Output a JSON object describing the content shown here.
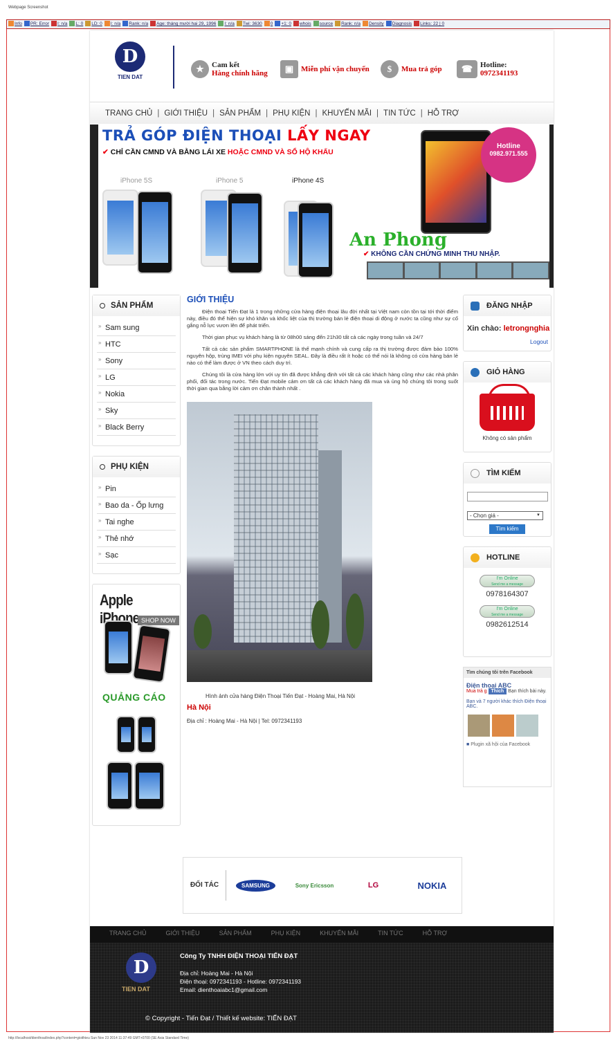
{
  "frame": {
    "title": "Webpage Screenshot",
    "status_url": "http://localhost/dienthoai/index.php?content=gioithieu Sun Nov 23 2014 11:37:49 GMT+0700 (SE Asia Standard Time)"
  },
  "seobar": {
    "items": [
      "Info",
      "PR: Error",
      "I: n/a",
      "L: 0",
      "LD: 0",
      "I: n/a",
      "Rank: n/a",
      "Age: tháng mười hai 29, 1996",
      "I: n/a",
      "Twi: 3630",
      "0",
      "+1: 0",
      "whois",
      "source",
      "Rank: n/a",
      "Density",
      "Diagnosis",
      "Links: 22 | 0"
    ]
  },
  "header": {
    "logo_text": "TIEN DAT",
    "features": [
      {
        "line1": "Cam kết",
        "line2": "Hàng chính hãng"
      },
      {
        "line1": "Miễn phí vận chuyển"
      },
      {
        "line1": "Mua trả góp"
      },
      {
        "line1": "Hotline:",
        "line2": "0972341193"
      }
    ]
  },
  "nav": [
    "TRANG CHỦ",
    "GIỚI THIỆU",
    "SẢN PHẨM",
    "PHỤ KIỆN",
    "KHUYẾN MÃI",
    "TIN TỨC",
    "HỖ TRỢ"
  ],
  "banner": {
    "title_a": "TRẢ GÓP ĐIỆN THOẠI",
    "title_b": "LẤY NGAY",
    "sub_a": "CHỈ CẦN CMND VÀ BẰNG LÁI XE",
    "sub_b": "HOẶC",
    "sub_c": "CMND VÀ SỔ HỘ KHẨU",
    "phones": [
      "iPhone 5S",
      "iPhone 5",
      "iPhone 4S"
    ],
    "hotline_label": "Hotline",
    "hotline_number": "0982.971.555",
    "brand": "An Phong",
    "bullet": "KHÔNG CẦN CHỨNG MINH THU NHẬP."
  },
  "left": {
    "products_title": "SẢN PHẨM",
    "products": [
      "Sam sung",
      "HTC",
      "Sony",
      "LG",
      "Nokia",
      "Sky",
      "Black Berry"
    ],
    "accessories_title": "PHỤ KIỆN",
    "accessories": [
      "Pin",
      "Bao da - Ốp lưng",
      "Tai nghe",
      "Thẻ nhớ",
      "Sạc"
    ],
    "ad_title": "Apple iPhone",
    "ad_shop": "SHOP NOW",
    "ads_label": "QUẢNG CÁO"
  },
  "main": {
    "title": "GIỚI THIỆU",
    "paragraphs": [
      "Điện thoại Tiến Đạt là 1 trong những cửa hàng điện thoại lâu đời nhất tại Việt nam còn tồn tại tới thời điểm này, điều đó thể hiện sự khó khăn và khốc liệt của thị trường bán lẻ điện thoại di động ở nước ta cũng như sự cố gắng nỗ lực vươn lên để phát triển.",
      "Thời gian phục vụ khách hàng là từ 08h00 sáng đến 21h30 tất cả các ngày trong tuần và 24/7",
      "Tất cả các sản phẩm SMARTPHONE là thế mạnh chính và cung cấp ra thị trường được đảm bảo 100% nguyên hộp, trùng IMEI với phụ kiện nguyên SEAL. Đây là điều rất ít hoặc có thể nói là không có cửa hàng bán lẻ nào có thể làm được ở VN theo cách duy trì.",
      "Chúng tôi là cửa hàng lớn với uy tín đã được khẳng định với tất cả các khách hàng cũng như các nhà phân phối, đối tác trong nước. Tiến Đạt mobile cảm ơn tất cả các khách hàng đã mua và ủng hộ chúng tôi trong suốt thời gian qua bằng lời cảm ơn chân thành nhất ."
    ],
    "caption": "Hình ảnh cửa hàng Điện Thoại Tiến Đạt - Hoàng Mai, Hà Nội",
    "city": "Hà Nội",
    "address": "Địa chỉ : Hoàng Mai - Hà Nội | Tel: 0972341193"
  },
  "right": {
    "login_title": "ĐĂNG NHẬP",
    "hello": "Xin chào:",
    "username": "letrongnghia",
    "logout": "Logout",
    "cart_title": "GIỎ HÀNG",
    "cart_empty": "Không có sản phẩm",
    "search_title": "TÌM KIẾM",
    "search_placeholder": "",
    "price_select": "- Chọn giá -",
    "search_button": "Tìm kiếm",
    "hotline_title": "HOTLINE",
    "online_label": "I'm Online",
    "online_sub": "Send me a message",
    "numbers": [
      "0978164307",
      "0982612514"
    ],
    "fb_title": "Tìm chúng tôi trên Facebook",
    "fb_page": "Điện thoại ABC",
    "fb_like": "Thích",
    "fb_like_text": "Bạn thích bài này.",
    "fb_mua": "Mua trả g",
    "fb_friends": "Bạn và 7 người khác thích Điện thoại ABC.",
    "fb_plugin": "Plugin xã hội của Facebook"
  },
  "partners": {
    "label": "ĐỐI TÁC",
    "brands": [
      "SAMSUNG",
      "Sony Ericsson",
      "LG",
      "NOKIA"
    ]
  },
  "footer": {
    "company": "Công Ty TNHH ĐIỆN THOẠI TIẾN ĐẠT",
    "logo_text": "TIEN DAT",
    "address": "Địa chỉ: Hoàng Mai - Hà Nội",
    "phone": "Điện thoại: 0972341193 - Hotline: 0972341193",
    "email": "Email: dienthoaiabc1@gmail.com",
    "copyright": "© Copyright - Tiến Đạt / Thiết kế website: TIẾN ĐẠT"
  }
}
